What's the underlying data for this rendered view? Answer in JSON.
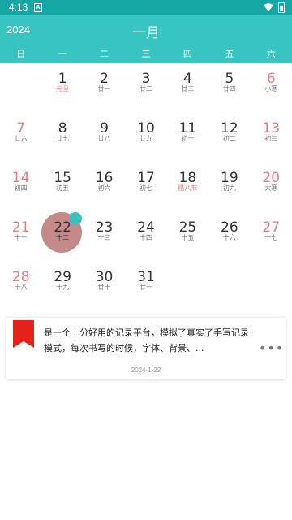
{
  "status_bar": {
    "time": "4:13",
    "notification_icon": "A"
  },
  "header": {
    "year": "2024",
    "month": "一月"
  },
  "weekdays": [
    "日",
    "一",
    "二",
    "三",
    "四",
    "五",
    "六"
  ],
  "days": [
    {
      "day": "1",
      "lunar": "元旦",
      "festival": true,
      "weekend": false
    },
    {
      "day": "2",
      "lunar": "廿一",
      "festival": false,
      "weekend": false
    },
    {
      "day": "3",
      "lunar": "廿二",
      "festival": false,
      "weekend": false
    },
    {
      "day": "4",
      "lunar": "廿三",
      "festival": false,
      "weekend": false
    },
    {
      "day": "5",
      "lunar": "廿四",
      "festival": false,
      "weekend": false
    },
    {
      "day": "6",
      "lunar": "小寒",
      "festival": false,
      "weekend": true
    },
    {
      "day": "7",
      "lunar": "廿六",
      "festival": false,
      "weekend": true
    },
    {
      "day": "8",
      "lunar": "廿七",
      "festival": false,
      "weekend": false
    },
    {
      "day": "9",
      "lunar": "廿八",
      "festival": false,
      "weekend": false
    },
    {
      "day": "10",
      "lunar": "廿九",
      "festival": false,
      "weekend": false
    },
    {
      "day": "11",
      "lunar": "初一",
      "festival": false,
      "weekend": false
    },
    {
      "day": "12",
      "lunar": "初二",
      "festival": false,
      "weekend": false
    },
    {
      "day": "13",
      "lunar": "初三",
      "festival": false,
      "weekend": true
    },
    {
      "day": "14",
      "lunar": "初四",
      "festival": false,
      "weekend": true
    },
    {
      "day": "15",
      "lunar": "初五",
      "festival": false,
      "weekend": false
    },
    {
      "day": "16",
      "lunar": "初六",
      "festival": false,
      "weekend": false
    },
    {
      "day": "17",
      "lunar": "初七",
      "festival": false,
      "weekend": false
    },
    {
      "day": "18",
      "lunar": "腊八节",
      "festival": true,
      "weekend": false
    },
    {
      "day": "19",
      "lunar": "初九",
      "festival": false,
      "weekend": false
    },
    {
      "day": "20",
      "lunar": "大寒",
      "festival": false,
      "weekend": true
    },
    {
      "day": "21",
      "lunar": "十一",
      "festival": false,
      "weekend": true
    },
    {
      "day": "22",
      "lunar": "十二",
      "festival": false,
      "weekend": false,
      "today": true
    },
    {
      "day": "23",
      "lunar": "十三",
      "festival": false,
      "weekend": false
    },
    {
      "day": "24",
      "lunar": "十四",
      "festival": false,
      "weekend": false
    },
    {
      "day": "25",
      "lunar": "十五",
      "festival": false,
      "weekend": false
    },
    {
      "day": "26",
      "lunar": "十六",
      "festival": false,
      "weekend": false
    },
    {
      "day": "27",
      "lunar": "十七",
      "festival": false,
      "weekend": true
    },
    {
      "day": "28",
      "lunar": "十八",
      "festival": false,
      "weekend": true
    },
    {
      "day": "29",
      "lunar": "十九",
      "festival": false,
      "weekend": false
    },
    {
      "day": "30",
      "lunar": "廿十",
      "festival": false,
      "weekend": false
    },
    {
      "day": "31",
      "lunar": "廿一",
      "festival": false,
      "weekend": false
    }
  ],
  "first_weekday_index": 1,
  "note_card": {
    "text": "是一个十分好用的记录平台，模拟了真实了手写记录模式，每次书写的时候，字体、背景、...",
    "date": "2024-1-22",
    "more_icon": "more-horizontal-icon",
    "bookmark_icon": "bookmark-icon"
  },
  "colors": {
    "header": "#38c4c1",
    "status_bar": "#16a6a3",
    "weekend": "#e57f7f",
    "today_circle": "#c48a8a",
    "today_dot": "#3bbfbf",
    "bookmark": "#e32219"
  }
}
